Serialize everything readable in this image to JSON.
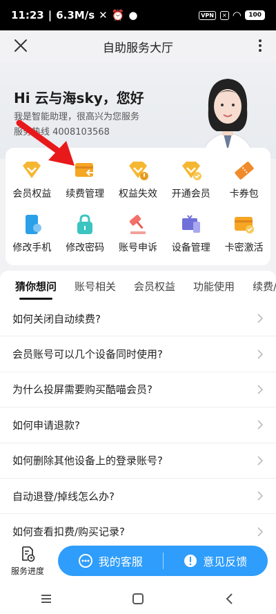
{
  "status": {
    "time": "11:23",
    "speed": "6.3M/s",
    "vpn": "VPN",
    "battery": "100"
  },
  "header": {
    "title": "自助服务大厅"
  },
  "hero": {
    "greeting": "Hi 云与海sky，您好",
    "intro": "我是智能助理，很高兴为您服务",
    "hotline": "服务热线 4008103568"
  },
  "services": [
    {
      "label": "会员权益",
      "icon": "vip-diamond-icon"
    },
    {
      "label": "续费管理",
      "icon": "card-renew-icon"
    },
    {
      "label": "权益失效",
      "icon": "vip-invalid-icon"
    },
    {
      "label": "开通会员",
      "icon": "vip-open-icon"
    },
    {
      "label": "卡券包",
      "icon": "coupon-icon"
    },
    {
      "label": "修改手机",
      "icon": "phone-icon"
    },
    {
      "label": "修改密码",
      "icon": "lock-icon"
    },
    {
      "label": "账号申诉",
      "icon": "gavel-icon"
    },
    {
      "label": "设备管理",
      "icon": "device-icon"
    },
    {
      "label": "卡密激活",
      "icon": "card-activate-icon"
    }
  ],
  "tabs": [
    "猜你想问",
    "账号相关",
    "会员权益",
    "功能使用",
    "续费/"
  ],
  "questions": [
    "如何关闭自动续费?",
    "会员账号可以几个设备同时使用?",
    "为什么投屏需要购买酷喵会员?",
    "如何申请退款?",
    "如何删除其他设备上的登录账号?",
    "自动退登/掉线怎么办?",
    "如何查看扣费/购买记录?"
  ],
  "bottom": {
    "progress": "服务进度",
    "service": "我的客服",
    "feedback": "意见反馈"
  },
  "colors": {
    "accent": "#2f9dfb",
    "orange": "#f5a623",
    "arrow": "#e8191b"
  }
}
